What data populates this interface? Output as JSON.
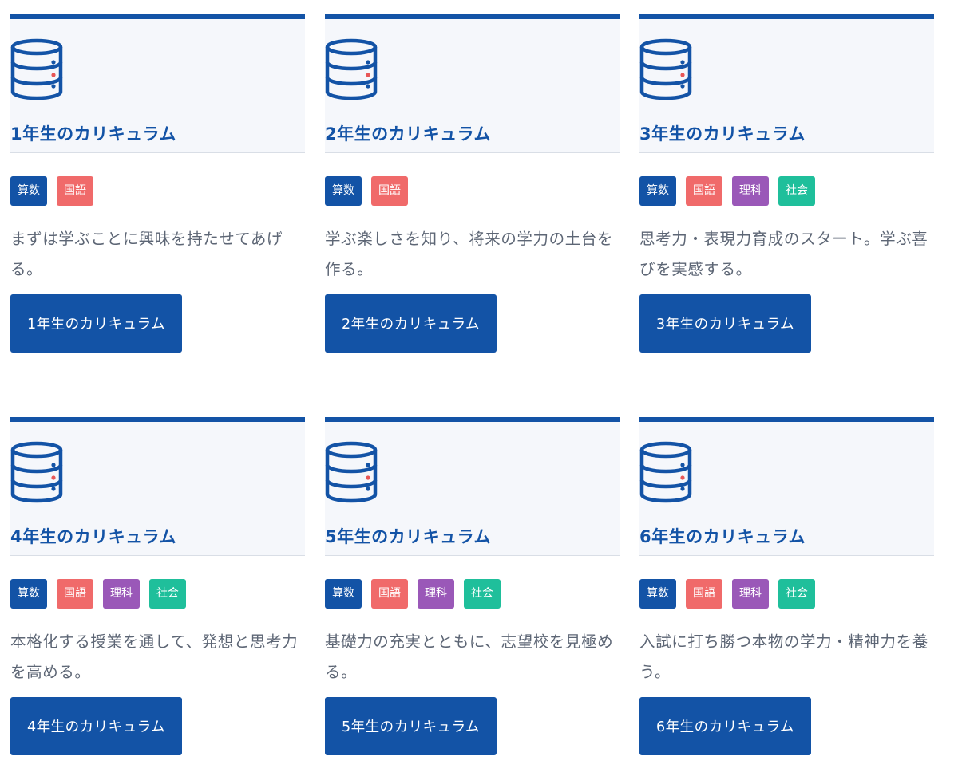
{
  "colors": {
    "accent": "#1353a6",
    "icon_accent_dot": "#e85656",
    "card_head_bg": "#f5f7fb",
    "tag_colors": {
      "算数": "#1353a6",
      "国語": "#f06a6a",
      "理科": "#9a58b8",
      "社会": "#1fbf9b"
    }
  },
  "icon": "database-icon",
  "cards": [
    {
      "title": "1年生のカリキュラム",
      "tags": [
        "算数",
        "国語"
      ],
      "description": "まずは学ぶことに興味を持たせてあげる。",
      "button_label": "1年生のカリキュラム"
    },
    {
      "title": "2年生のカリキュラム",
      "tags": [
        "算数",
        "国語"
      ],
      "description": "学ぶ楽しさを知り、将来の学力の土台を作る。",
      "button_label": "2年生のカリキュラム"
    },
    {
      "title": "3年生のカリキュラム",
      "tags": [
        "算数",
        "国語",
        "理科",
        "社会"
      ],
      "description": "思考力・表現力育成のスタート。学ぶ喜びを実感する。",
      "button_label": "3年生のカリキュラム"
    },
    {
      "title": "4年生のカリキュラム",
      "tags": [
        "算数",
        "国語",
        "理科",
        "社会"
      ],
      "description": "本格化する授業を通して、発想と思考力を高める。",
      "button_label": "4年生のカリキュラム"
    },
    {
      "title": "5年生のカリキュラム",
      "tags": [
        "算数",
        "国語",
        "理科",
        "社会"
      ],
      "description": "基礎力の充実とともに、志望校を見極める。",
      "button_label": "5年生のカリキュラム"
    },
    {
      "title": "6年生のカリキュラム",
      "tags": [
        "算数",
        "国語",
        "理科",
        "社会"
      ],
      "description": "入試に打ち勝つ本物の学力・精神力を養う。",
      "button_label": "6年生のカリキュラム"
    }
  ]
}
